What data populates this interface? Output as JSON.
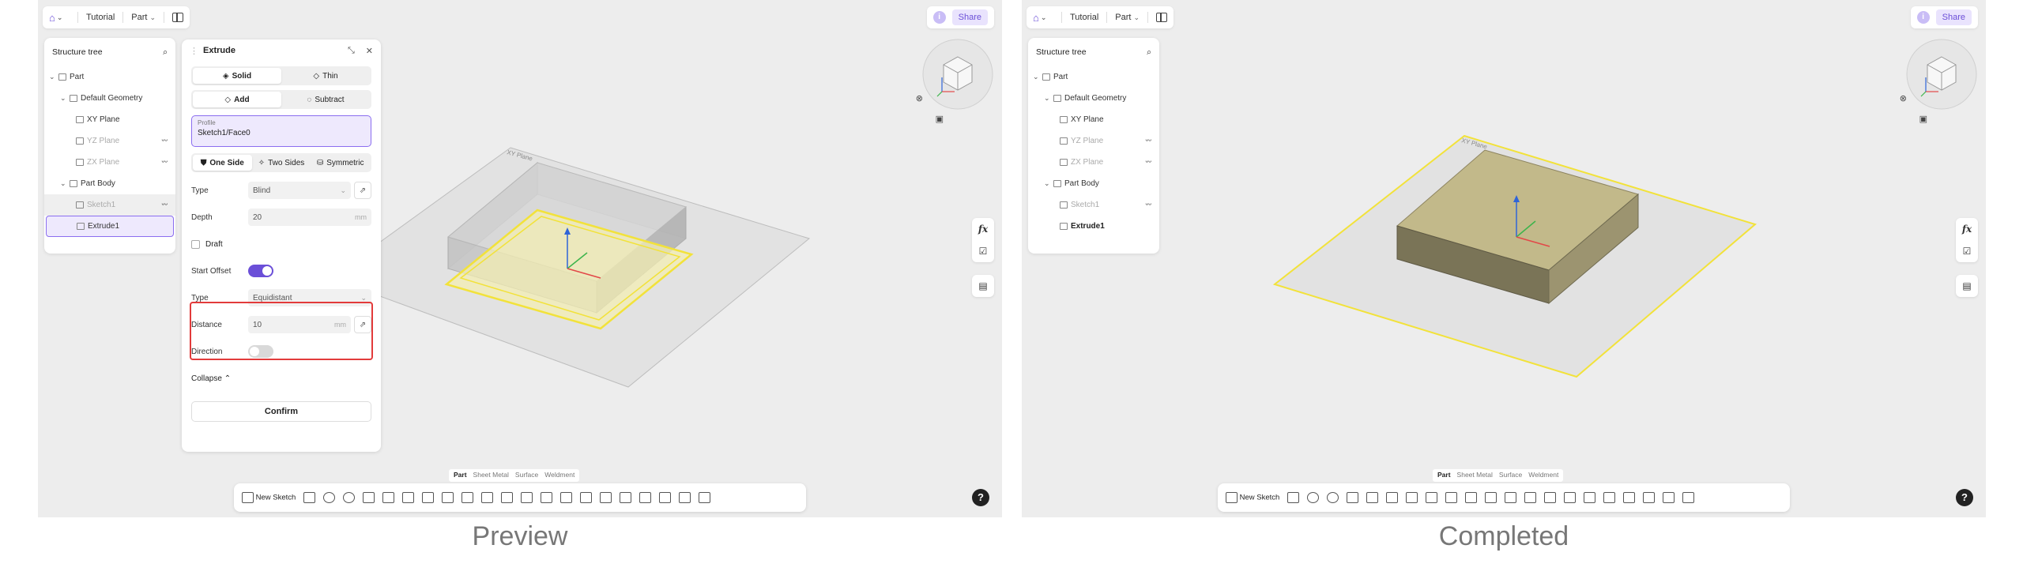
{
  "captions": {
    "preview": "Preview",
    "completed": "Completed"
  },
  "topbar": {
    "crumb_tutorial": "Tutorial",
    "crumb_part": "Part",
    "share": "Share",
    "info": "i"
  },
  "tree": {
    "title": "Structure tree",
    "items": [
      {
        "label": "Part"
      },
      {
        "label": "Default Geometry"
      },
      {
        "label": "XY Plane"
      },
      {
        "label": "YZ Plane"
      },
      {
        "label": "ZX Plane"
      },
      {
        "label": "Part Body"
      },
      {
        "label": "Sketch1"
      },
      {
        "label": "Extrude1"
      }
    ]
  },
  "extrude": {
    "title": "Extrude",
    "mode": {
      "solid": "Solid",
      "thin": "Thin"
    },
    "op": {
      "add": "Add",
      "subtract": "Subtract"
    },
    "profile_label": "Profile",
    "profile_value": "Sketch1/Face0",
    "sides": {
      "one": "One Side",
      "two": "Two Sides",
      "sym": "Symmetric"
    },
    "type_label": "Type",
    "type_value": "Blind",
    "depth_label": "Depth",
    "depth_value": "20",
    "unit": "mm",
    "draft_label": "Draft",
    "start_offset_label": "Start Offset",
    "offset_type_label": "Type",
    "offset_type_value": "Equidistant",
    "distance_label": "Distance",
    "distance_value": "10",
    "direction_label": "Direction",
    "collapse_label": "Collapse",
    "confirm_label": "Confirm"
  },
  "plane_label": "XY Plane",
  "side_tools": {
    "fx": "fx"
  },
  "workbench_tabs": [
    "Part",
    "Sheet Metal",
    "Surface",
    "Weldment"
  ],
  "toolbar": {
    "new_sketch": "New Sketch"
  },
  "help": "?",
  "colors": {
    "accent": "#6b4fd8",
    "highlight_box": "#e23b3b",
    "sketch_yellow": "#f2e23a",
    "solid_fill": "#c2b98a"
  }
}
